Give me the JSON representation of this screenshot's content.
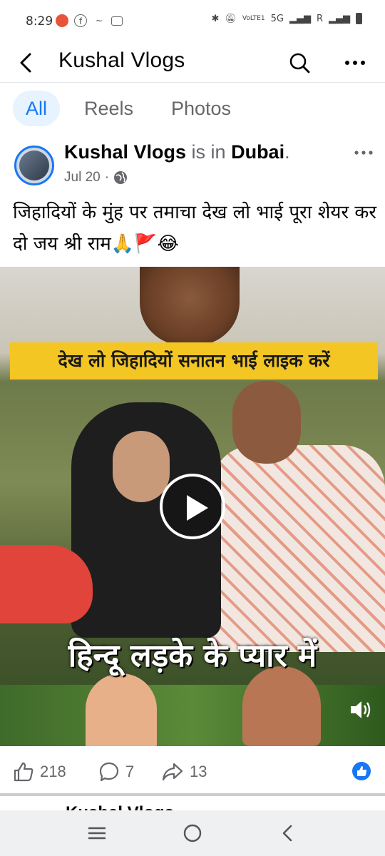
{
  "status_bar": {
    "time": "8:29",
    "network_label": "5G",
    "roaming_label": "R",
    "volte_label": "VoLTE1"
  },
  "header": {
    "title": "Kushal Vlogs"
  },
  "tabs": [
    {
      "label": "All",
      "active": true
    },
    {
      "label": "Reels",
      "active": false
    },
    {
      "label": "Photos",
      "active": false
    }
  ],
  "post": {
    "author": "Kushal Vlogs",
    "connector": "is in",
    "location": "Dubai",
    "date": "Jul 20",
    "privacy_icon": "globe-icon",
    "text": "जिहादियों के मुंह पर तमाचा देख लो भाई पूरा शेयर कर दो जय श्री राम🙏🚩😂",
    "video": {
      "caption_top": "देख लो जिहादियों सनातन भाई लाइक करें",
      "caption_bottom": "हिन्दू लड़के के प्यार में"
    },
    "likes": "218",
    "comments": "7",
    "shares": "13"
  },
  "next_post_peek": "Kushal Vlogs",
  "colors": {
    "accent": "#1877f2",
    "tab_active_bg": "#e7f3ff",
    "caption_bg": "#f4c623"
  }
}
